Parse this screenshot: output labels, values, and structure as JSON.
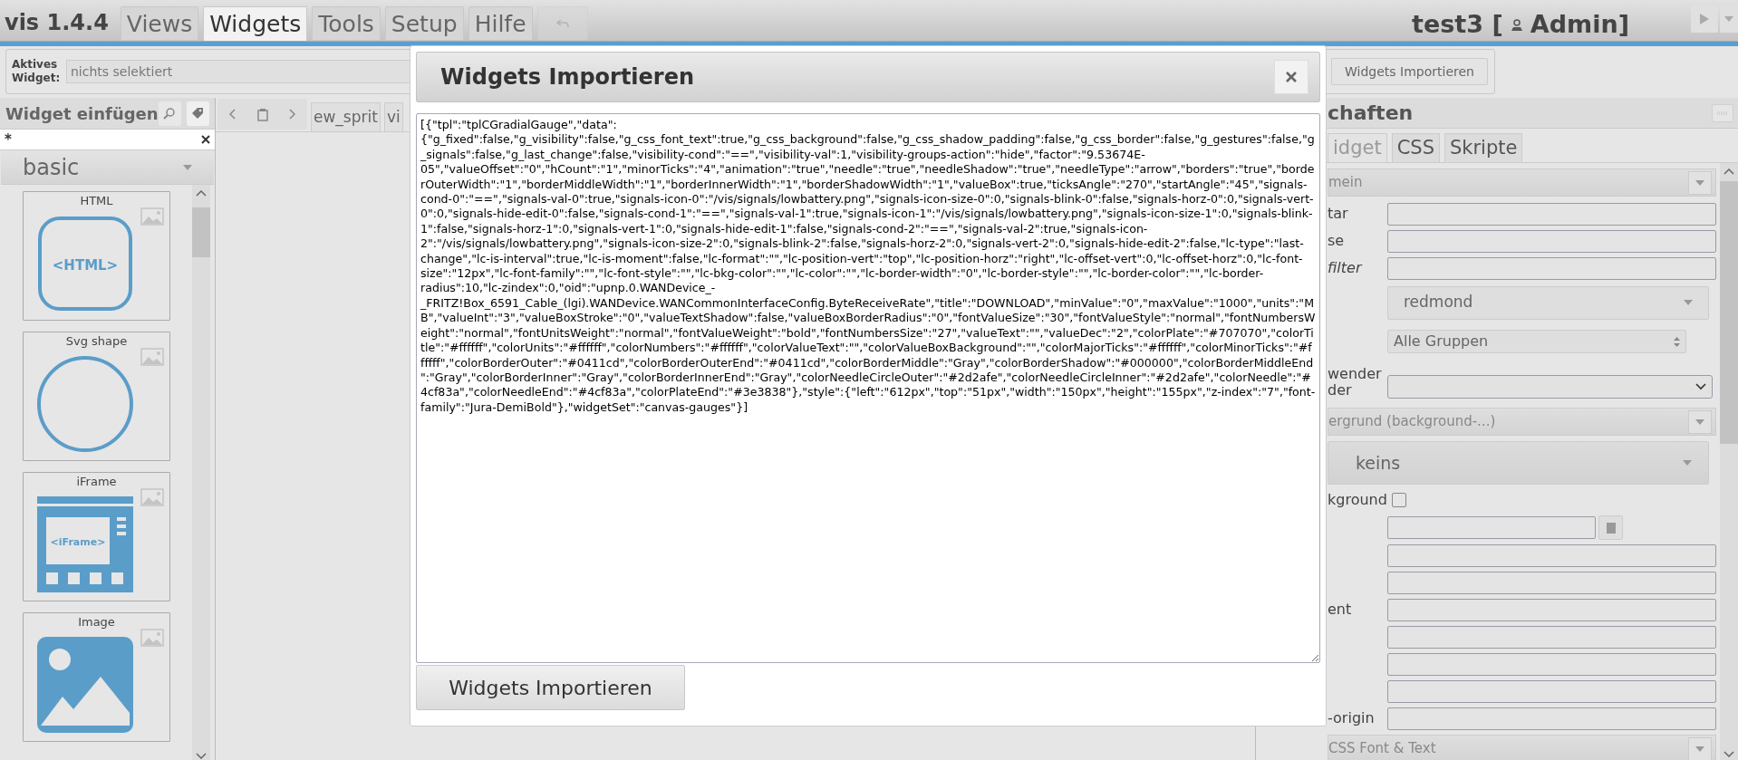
{
  "app": {
    "title": "vis 1.4.4"
  },
  "menu": [
    {
      "label": "Views",
      "selected": false
    },
    {
      "label": "Widgets",
      "selected": true
    },
    {
      "label": "Tools",
      "selected": false
    },
    {
      "label": "Setup",
      "selected": false
    },
    {
      "label": "Hilfe",
      "selected": false
    }
  ],
  "undo_button": {
    "disabled": true
  },
  "project": {
    "name": "test3 [",
    "user": "Admin]"
  },
  "toolbar": {
    "active_widget_label": "Aktives Widget:",
    "active_widget_value": "nichts selektiert",
    "import_button": "Widgets Importieren"
  },
  "left_panel": {
    "title": "Widget einfügen",
    "filter": "*",
    "set": "basic",
    "widgets": [
      {
        "label": "HTML",
        "kind": "html",
        "icon_text": "<HTML>"
      },
      {
        "label": "Svg shape",
        "kind": "svg"
      },
      {
        "label": "iFrame",
        "kind": "iframe",
        "icon_text": "<iFrame>"
      },
      {
        "label": "Image",
        "kind": "image"
      }
    ]
  },
  "view_tabs": [
    {
      "label": "ew_sprit"
    },
    {
      "label": "vi"
    }
  ],
  "dialog": {
    "title": "Widgets Importieren",
    "text": "[{\"tpl\":\"tplCGradialGauge\",\"data\":{\"g_fixed\":false,\"g_visibility\":false,\"g_css_font_text\":true,\"g_css_background\":false,\"g_css_shadow_padding\":false,\"g_css_border\":false,\"g_gestures\":false,\"g_signals\":false,\"g_last_change\":false,\"visibility-cond\":\"==\",\"visibility-val\":1,\"visibility-groups-action\":\"hide\",\"factor\":\"9.53674E-05\",\"valueOffset\":\"0\",\"hCount\":\"1\",\"minorTicks\":\"4\",\"animation\":\"true\",\"needle\":\"true\",\"needleShadow\":\"true\",\"needleType\":\"arrow\",\"borders\":\"true\",\"borderOuterWidth\":\"1\",\"borderMiddleWidth\":\"1\",\"borderInnerWidth\":\"1\",\"borderShadowWidth\":\"1\",\"valueBox\":true,\"ticksAngle\":\"270\",\"startAngle\":\"45\",\"signals-cond-0\":\"==\",\"signals-val-0\":true,\"signals-icon-0\":\"/vis/signals/lowbattery.png\",\"signals-icon-size-0\":0,\"signals-blink-0\":false,\"signals-horz-0\":0,\"signals-vert-0\":0,\"signals-hide-edit-0\":false,\"signals-cond-1\":\"==\",\"signals-val-1\":true,\"signals-icon-1\":\"/vis/signals/lowbattery.png\",\"signals-icon-size-1\":0,\"signals-blink-1\":false,\"signals-horz-1\":0,\"signals-vert-1\":0,\"signals-hide-edit-1\":false,\"signals-cond-2\":\"==\",\"signals-val-2\":true,\"signals-icon-2\":\"/vis/signals/lowbattery.png\",\"signals-icon-size-2\":0,\"signals-blink-2\":false,\"signals-horz-2\":0,\"signals-vert-2\":0,\"signals-hide-edit-2\":false,\"lc-type\":\"last-change\",\"lc-is-interval\":true,\"lc-is-moment\":false,\"lc-format\":\"\",\"lc-position-vert\":\"top\",\"lc-position-horz\":\"right\",\"lc-offset-vert\":0,\"lc-offset-horz\":0,\"lc-font-size\":\"12px\",\"lc-font-family\":\"\",\"lc-font-style\":\"\",\"lc-bkg-color\":\"\",\"lc-color\":\"\",\"lc-border-width\":\"0\",\"lc-border-style\":\"\",\"lc-border-color\":\"\",\"lc-border-radius\":10,\"lc-zindex\":0,\"oid\":\"upnp.0.WANDevice_-_FRITZ!Box_6591_Cable_(lgi).WANDevice.WANCommonInterfaceConfig.ByteReceiveRate\",\"title\":\"DOWNLOAD\",\"minValue\":\"0\",\"maxValue\":\"1000\",\"units\":\"MB\",\"valueInt\":\"3\",\"valueBoxStroke\":\"0\",\"valueTextShadow\":false,\"valueBoxBorderRadius\":\"0\",\"fontValueSize\":\"30\",\"fontValueStyle\":\"normal\",\"fontNumbersWeight\":\"normal\",\"fontUnitsWeight\":\"normal\",\"fontValueWeight\":\"bold\",\"fontNumbersSize\":\"27\",\"valueText\":\"\",\"valueDec\":\"2\",\"colorPlate\":\"#707070\",\"colorTitle\":\"#ffffff\",\"colorUnits\":\"#ffffff\",\"colorNumbers\":\"#ffffff\",\"colorValueText\":\"\",\"colorValueBoxBackground\":\"\",\"colorMajorTicks\":\"#ffffff\",\"colorMinorTicks\":\"#ffffff\",\"colorBorderOuter\":\"#0411cd\",\"colorBorderOuterEnd\":\"#0411cd\",\"colorBorderMiddle\":\"Gray\",\"colorBorderShadow\":\"#000000\",\"colorBorderMiddleEnd\":\"Gray\",\"colorBorderInner\":\"Gray\",\"colorBorderInnerEnd\":\"Gray\",\"colorNeedleCircleOuter\":\"#2d2afe\",\"colorNeedleCircleInner\":\"#2d2afe\",\"colorNeedle\":\"#4cf83a\",\"colorNeedleEnd\":\"#4cf83a\",\"colorPlateEnd\":\"#3e3838\"},\"style\":{\"left\":\"612px\",\"top\":\"51px\",\"width\":\"150px\",\"height\":\"155px\",\"z-index\":\"7\",\"font-family\":\"Jura-DemiBold\"},\"widgetSet\":\"canvas-gauges\"}]",
    "button": "Widgets Importieren"
  },
  "properties": {
    "title": "chaften",
    "tabs": [
      {
        "label": "idget",
        "disabled": true
      },
      {
        "label": "CSS",
        "disabled": false
      },
      {
        "label": "Skripte",
        "disabled": false
      }
    ],
    "rows": [
      {
        "kind": "section",
        "label": "mein"
      },
      {
        "kind": "input",
        "label": "tar"
      },
      {
        "kind": "input",
        "label": "se"
      },
      {
        "kind": "input",
        "label": "filter",
        "italic": true
      },
      {
        "kind": "theme",
        "value": "redmond"
      },
      {
        "kind": "select",
        "value": "Alle Gruppen"
      },
      {
        "kind": "combo",
        "label": "wender der"
      },
      {
        "kind": "section",
        "label": "ergrund (background-...)"
      },
      {
        "kind": "big_dropdown",
        "value": "keins"
      },
      {
        "kind": "checkbox",
        "label": "kground",
        "checked": false
      },
      {
        "kind": "color"
      },
      {
        "kind": "input"
      },
      {
        "kind": "input"
      },
      {
        "kind": "input",
        "label": "ent"
      },
      {
        "kind": "input"
      },
      {
        "kind": "input"
      },
      {
        "kind": "input"
      },
      {
        "kind": "input",
        "label": "-origin"
      },
      {
        "kind": "section",
        "label": "CSS Font & Text"
      }
    ]
  }
}
